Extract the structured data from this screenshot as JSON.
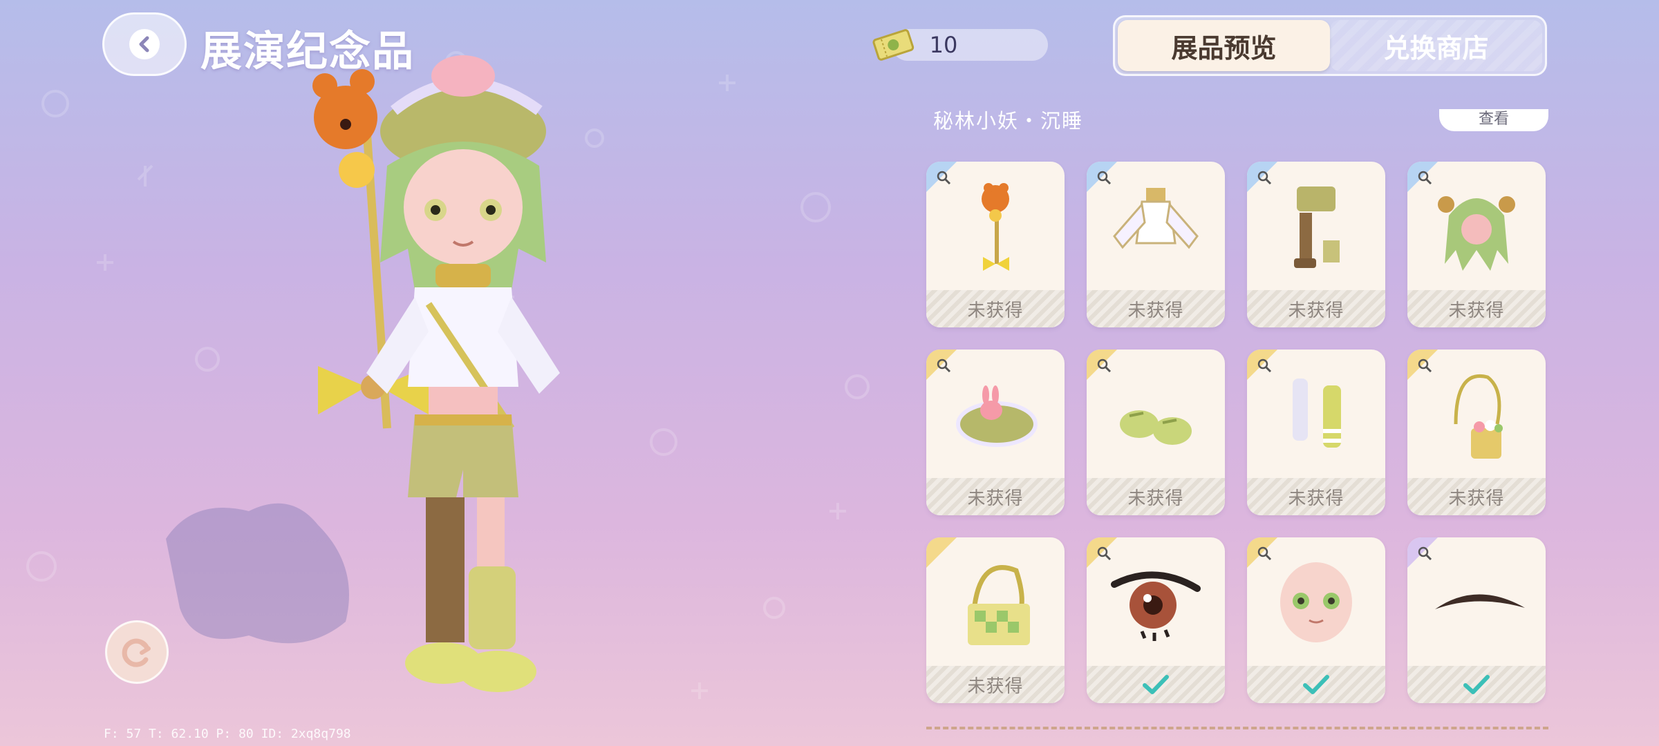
{
  "header": {
    "title": "展演纪念品",
    "back_icon": "chevron-left-icon"
  },
  "currency": {
    "icon": "ticket-icon",
    "value": "10"
  },
  "tabs": [
    {
      "label": "展品预览",
      "active": true
    },
    {
      "label": "兑换商店",
      "active": false
    }
  ],
  "set": {
    "name": "秘林小妖・沉睡",
    "view_label": "查看"
  },
  "items": [
    {
      "name": "squirrel-staff",
      "status": "未获得",
      "obtained": false
    },
    {
      "name": "white-jacket",
      "status": "未获得",
      "obtained": false
    },
    {
      "name": "brown-boots-outfit",
      "status": "未获得",
      "obtained": false
    },
    {
      "name": "green-hair",
      "status": "未获得",
      "obtained": false
    },
    {
      "name": "bunny-beret",
      "status": "未获得",
      "obtained": false
    },
    {
      "name": "green-shoes",
      "status": "未获得",
      "obtained": false
    },
    {
      "name": "striped-socks",
      "status": "未获得",
      "obtained": false
    },
    {
      "name": "flower-basket-bag",
      "status": "未获得",
      "obtained": false
    },
    {
      "name": "checkered-bag",
      "status": "未获得",
      "obtained": false
    },
    {
      "name": "brown-eye",
      "status": "",
      "obtained": true
    },
    {
      "name": "face",
      "status": "",
      "obtained": true
    },
    {
      "name": "eyebrow",
      "status": "",
      "obtained": true
    }
  ],
  "rotate_icon": "rotate-icon",
  "debug": {
    "text": "F: 57    T: 62.10    P: 80    ID: 2xq8q798"
  },
  "colors": {
    "accent_check": "#3cc0b8",
    "tab_active_bg": "#fbf1e6",
    "card_bg": "#fbf4ec"
  }
}
